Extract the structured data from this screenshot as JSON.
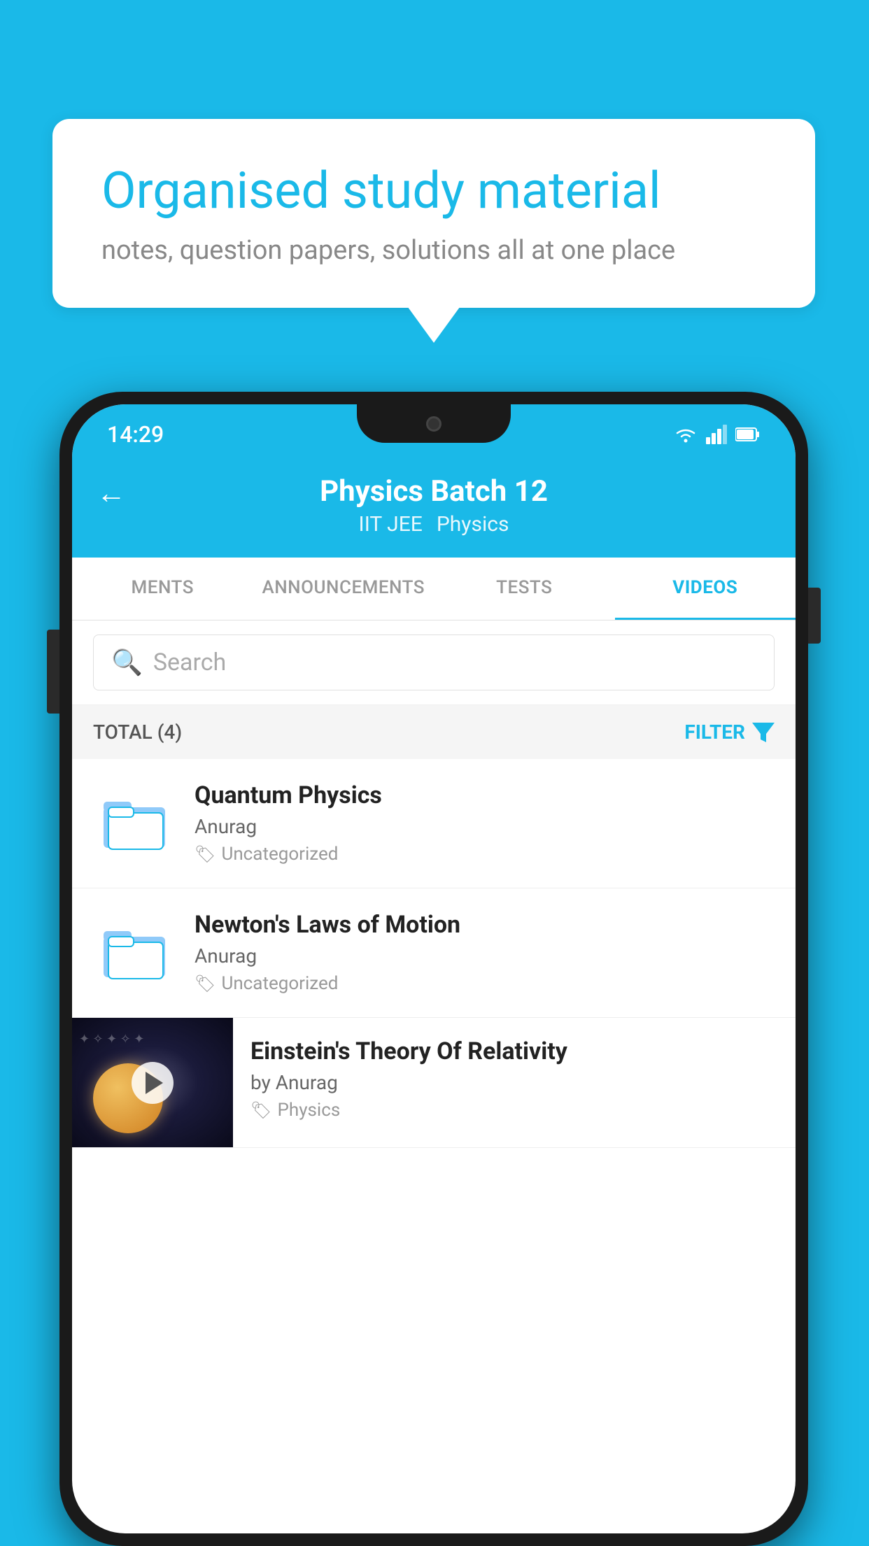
{
  "background_color": "#1ab9e8",
  "speech_bubble": {
    "title": "Organised study material",
    "subtitle": "notes, question papers, solutions all at one place"
  },
  "phone": {
    "status_bar": {
      "time": "14:29",
      "icons": [
        "wifi",
        "signal",
        "battery"
      ]
    },
    "header": {
      "back_label": "←",
      "title": "Physics Batch 12",
      "subtitle_tag1": "IIT JEE",
      "subtitle_tag2": "Physics"
    },
    "tabs": [
      {
        "label": "MENTS",
        "active": false
      },
      {
        "label": "ANNOUNCEMENTS",
        "active": false
      },
      {
        "label": "TESTS",
        "active": false
      },
      {
        "label": "VIDEOS",
        "active": true
      }
    ],
    "search": {
      "placeholder": "Search"
    },
    "filter": {
      "total_label": "TOTAL (4)",
      "filter_label": "FILTER"
    },
    "videos": [
      {
        "id": 1,
        "title": "Quantum Physics",
        "author": "Anurag",
        "tag": "Uncategorized",
        "type": "folder"
      },
      {
        "id": 2,
        "title": "Newton's Laws of Motion",
        "author": "Anurag",
        "tag": "Uncategorized",
        "type": "folder"
      },
      {
        "id": 3,
        "title": "Einstein's Theory Of Relativity",
        "author": "by Anurag",
        "tag": "Physics",
        "type": "video"
      }
    ]
  }
}
